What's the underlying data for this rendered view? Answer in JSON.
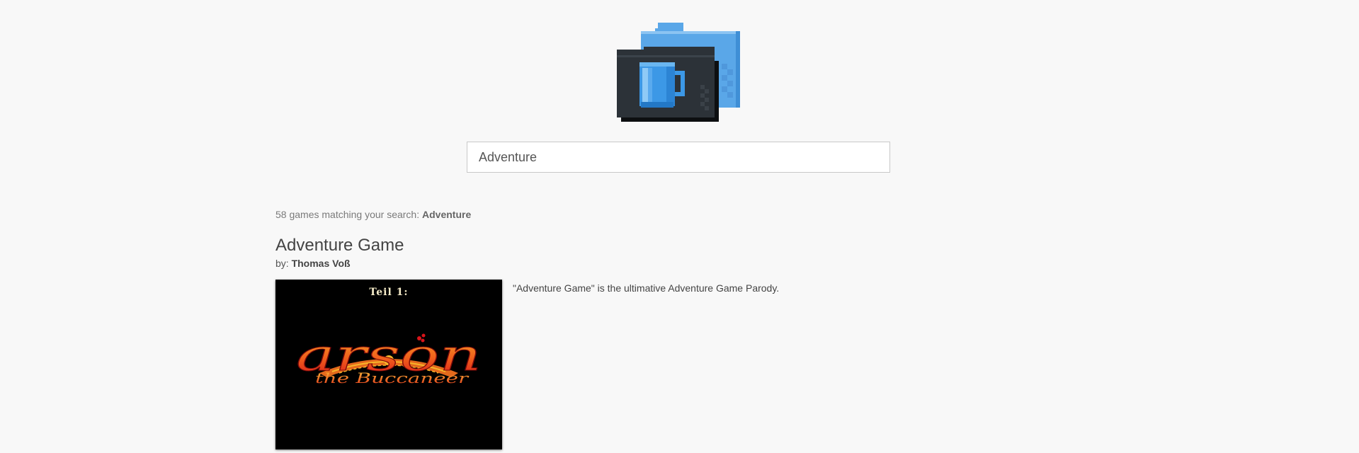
{
  "search": {
    "value": "Adventure",
    "placeholder": ""
  },
  "results": {
    "summary_prefix": "58 games matching your search:",
    "query": "Adventure"
  },
  "games": [
    {
      "title": "Adventure Game",
      "by_label": "by:",
      "author": "Thomas Voß",
      "description": "\"Adventure Game\" is the ultimative Adventure Game Parody.",
      "thumbnail": {
        "heading": "Teil 1:",
        "logo_word": "arson",
        "logo_subtitle": "the Buccaneer"
      }
    }
  ],
  "colors": {
    "background": "#f8f8f8",
    "folder_blue": "#5aa7e8",
    "folder_dark": "#2c3238",
    "mug_blue": "#3c98e6",
    "logo_red": "#e8361a",
    "logo_orange": "#f5a020"
  },
  "icons": {
    "site_logo": "folder-mug-icon"
  }
}
